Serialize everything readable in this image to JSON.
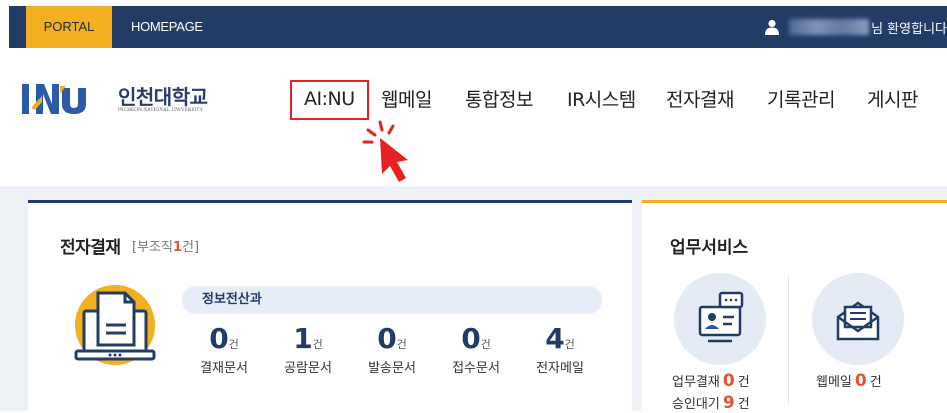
{
  "topbar": {
    "portal_label": "PORTAL",
    "homepage_label": "HOMEPAGE",
    "welcome_text": "님 환영합니다"
  },
  "logo": {
    "korean": "인천대학교",
    "english": "INCHEON NATIONAL UNIVERSITY"
  },
  "nav": {
    "items": [
      {
        "label": "AI:NU"
      },
      {
        "label": "웹메일"
      },
      {
        "label": "통합정보"
      },
      {
        "label": "IR시스템"
      },
      {
        "label": "전자결재"
      },
      {
        "label": "기록관리"
      },
      {
        "label": "게시판"
      }
    ]
  },
  "approval": {
    "title": "전자결재",
    "sub_prefix": "[부조직",
    "sub_count": "1",
    "sub_suffix": "건]",
    "department": "정보전산과",
    "counts": [
      {
        "value": "0",
        "unit": "건",
        "label": "결재문서"
      },
      {
        "value": "1",
        "unit": "건",
        "label": "공람문서"
      },
      {
        "value": "0",
        "unit": "건",
        "label": "발송문서"
      },
      {
        "value": "0",
        "unit": "건",
        "label": "접수문서"
      },
      {
        "value": "4",
        "unit": "건",
        "label": "전자메일"
      }
    ]
  },
  "services": {
    "title": "업무서비스",
    "work_approval_label": "업무결재",
    "work_approval_count": "0",
    "pending_label": "승인대기",
    "pending_count": "9",
    "webmail_label": "웹메일",
    "webmail_count": "0",
    "unit": "건"
  },
  "colors": {
    "navy": "#233c66",
    "gold": "#f2b01e",
    "highlight_red": "#e52222",
    "count_orange": "#e5522e"
  }
}
